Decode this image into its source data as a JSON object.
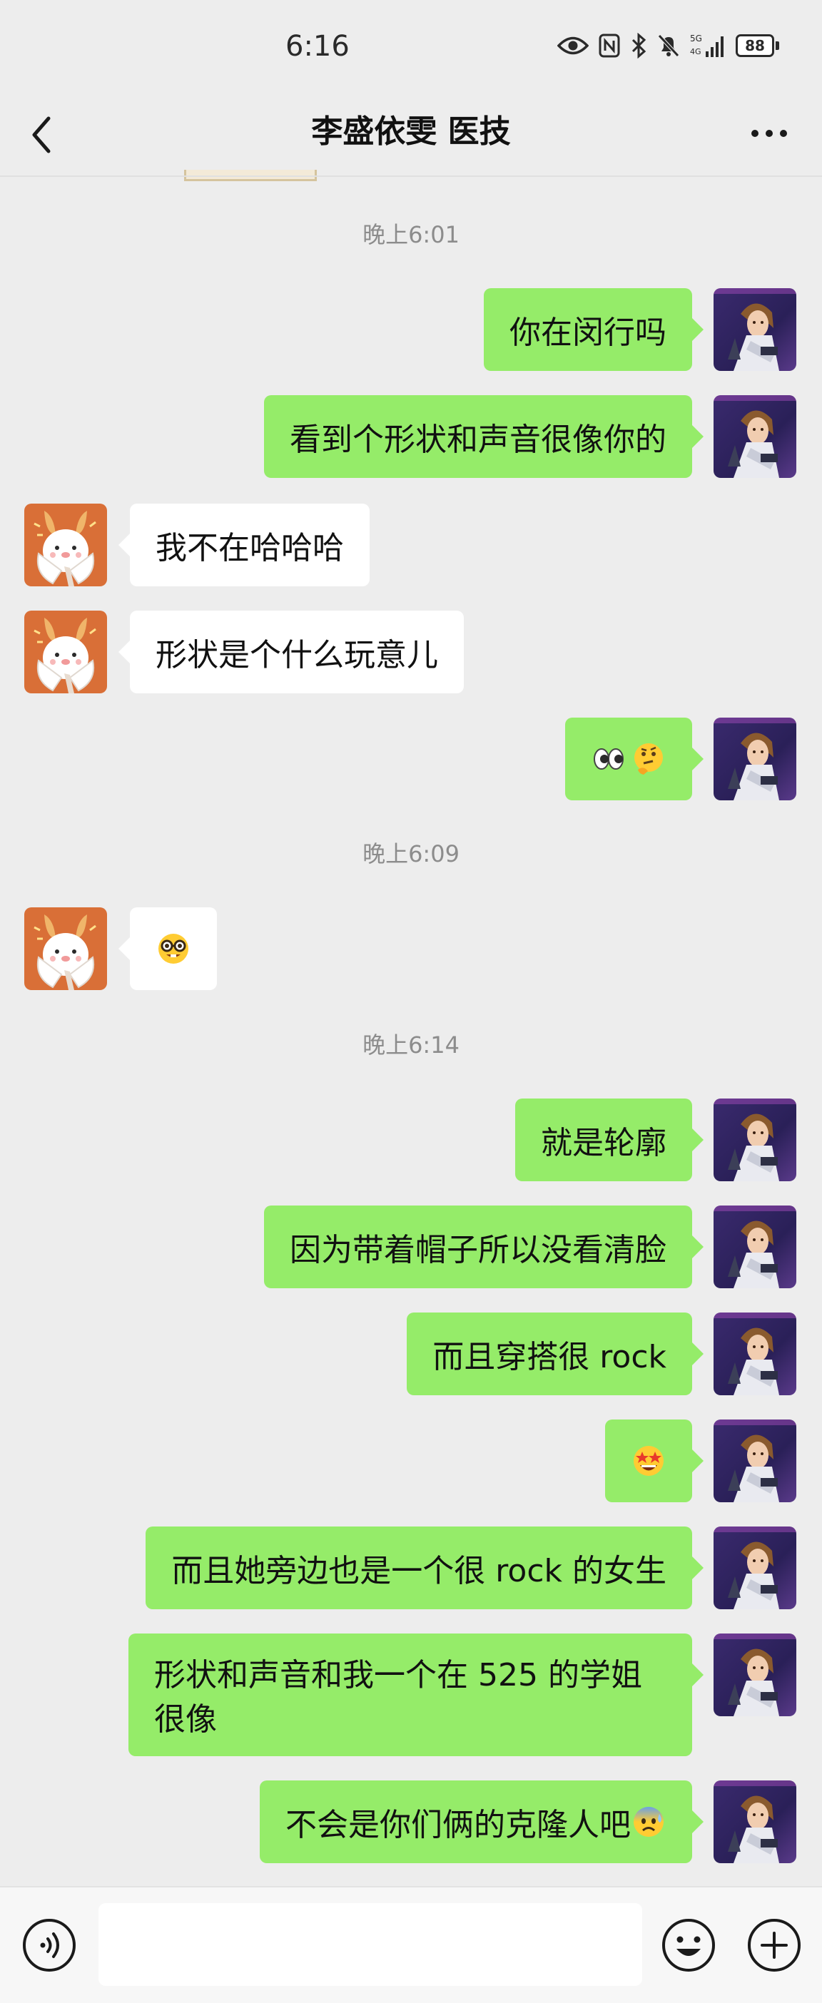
{
  "status_bar": {
    "time": "6:16",
    "battery": "88",
    "network_label_top": "5G",
    "network_label_bottom": "4G"
  },
  "header": {
    "title": "李盛依雯 医技"
  },
  "timestamps": [
    "晚上6:01",
    "晚上6:09",
    "晚上6:14"
  ],
  "messages": [
    {
      "from": "me",
      "text": "你在闵行吗"
    },
    {
      "from": "me",
      "text": "看到个形状和声音很像你的"
    },
    {
      "from": "them",
      "text": "我不在哈哈哈"
    },
    {
      "from": "them",
      "text": "形状是个什么玩意儿"
    },
    {
      "from": "me",
      "emoji": [
        "eyes",
        "thinking-face"
      ]
    },
    {
      "from": "them",
      "emoji": [
        "nerd-face"
      ]
    },
    {
      "from": "me",
      "text": "就是轮廓"
    },
    {
      "from": "me",
      "text": "因为带着帽子所以没看清脸"
    },
    {
      "from": "me",
      "text": "而且穿搭很 rock"
    },
    {
      "from": "me",
      "emoji": [
        "star-struck"
      ]
    },
    {
      "from": "me",
      "text": "而且她旁边也是一个很 rock 的女生"
    },
    {
      "from": "me",
      "text": "形状和声音和我一个在 525 的学姐很像"
    },
    {
      "from": "me",
      "text": "不会是你们俩的克隆人吧",
      "emoji": [
        "anxious-face-with-sweat"
      ]
    }
  ],
  "colors": {
    "background": "#ededed",
    "my_bubble": "#95ec69",
    "their_bubble": "#ffffff",
    "timestamp_text": "#8c8c8c"
  },
  "icons": {
    "back": "chevron-left-icon",
    "more": "more-dots-icon",
    "voice": "voice-icon",
    "emoji": "emoji-icon",
    "plus": "plus-icon"
  }
}
